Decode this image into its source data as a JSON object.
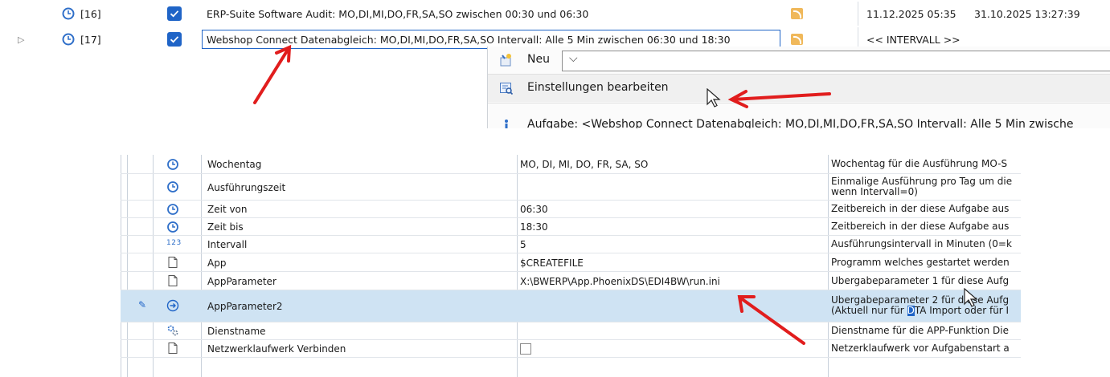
{
  "task_list": {
    "rows": [
      {
        "number": "[16]",
        "description": "ERP-Suite Software Audit: MO,DI,MI,DO,FR,SA,SO zwischen 00:30 und 06:30",
        "col1": "11.12.2025 05:35",
        "col2": "31.10.2025 13:27:39"
      },
      {
        "number": "[17]",
        "description": "Webshop Connect Datenabgleich: MO,DI,MI,DO,FR,SA,SO Intervall: Alle 5 Min zwischen 06:30 und 18:30",
        "col1": "<< INTERVALL >>",
        "col2": ""
      }
    ]
  },
  "context_menu": {
    "new_label": "Neu",
    "edit_label": "Einstellungen bearbeiten",
    "task_label": "Aufgabe: <Webshop Connect Datenabgleich: MO,DI,MI,DO,FR,SA,SO Intervall: Alle 5 Min zwische"
  },
  "property_grid": {
    "rows": [
      {
        "name": "Wochentag",
        "value": "MO, DI, MI, DO, FR, SA, SO",
        "desc": "Wochentag für die Ausführung MO-S"
      },
      {
        "name": "Ausführungszeit",
        "value": "",
        "desc": "Einmalige Ausführung pro Tag um die",
        "desc2": "wenn Intervall=0)"
      },
      {
        "name": "Zeit von",
        "value": "06:30",
        "desc": "Zeitbereich in der diese Aufgabe aus"
      },
      {
        "name": "Zeit bis",
        "value": "18:30",
        "desc": "Zeitbereich in der diese Aufgabe aus"
      },
      {
        "name": "Intervall",
        "value": "5",
        "desc": "Ausführungsintervall in Minuten (0=k"
      },
      {
        "name": "App",
        "value": "$CREATEFILE",
        "desc": "Programm welches gestartet werden"
      },
      {
        "name": "AppParameter",
        "value": "X:\\BWERP\\App.PhoenixDS\\EDI4BW\\run.ini",
        "desc": "Übergabeparameter 1 für diese Aufg"
      },
      {
        "name": "AppParameter2",
        "value": "",
        "desc": "Übergabeparameter 2 für diese Aufg",
        "desc2_a": "(Aktuell nur für ",
        "desc2_hl": "D",
        "desc2_b": "TA Import oder für I"
      },
      {
        "name": "Dienstname",
        "value": "",
        "desc": "Dienstname für die APP-Funktion Die"
      },
      {
        "name": "Netzwerklaufwerk Verbinden",
        "value": "",
        "desc": "Netzerklaufwerk vor Aufgabenstart a"
      }
    ]
  },
  "colors": {
    "accent": "#1f64c7",
    "selection": "#cfe3f3",
    "annotation_arrow": "#e11d1d"
  }
}
